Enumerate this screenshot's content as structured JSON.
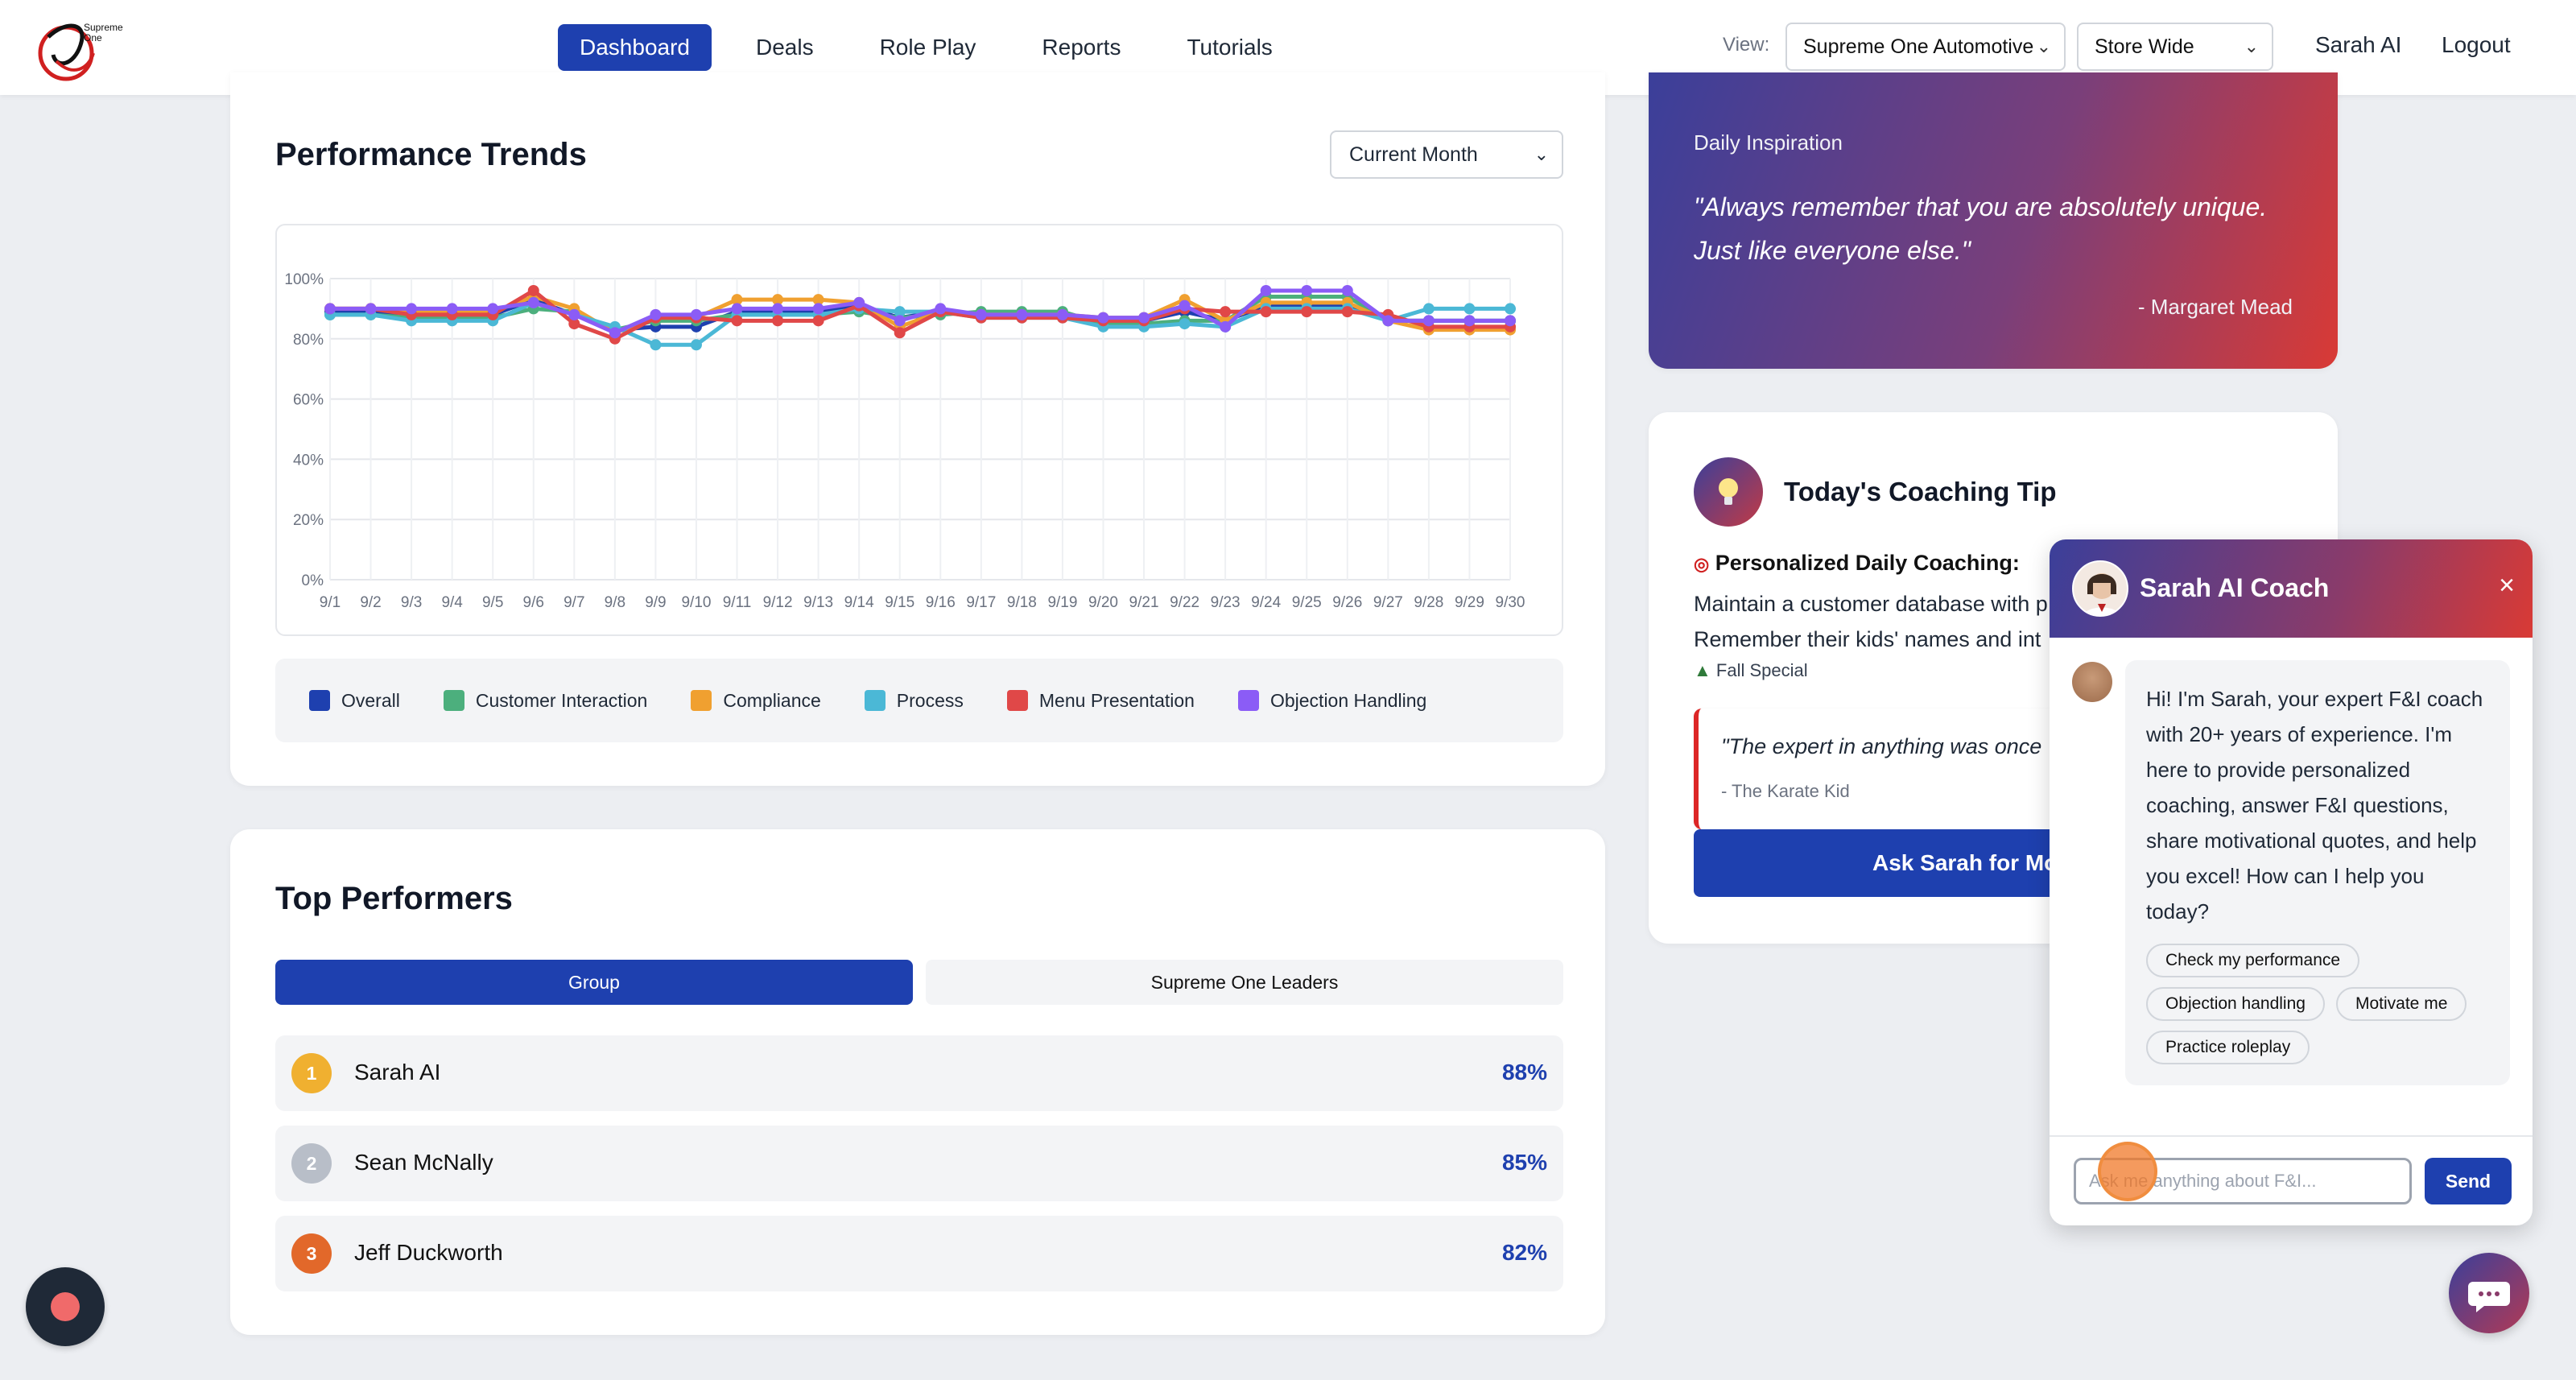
{
  "nav": {
    "logo_text": "Supreme One",
    "links": [
      "Dashboard",
      "Deals",
      "Role Play",
      "Reports",
      "Tutorials"
    ],
    "active": "Dashboard",
    "view_label": "View:",
    "dealer_select": "Supreme One Automotive",
    "scope_select": "Store Wide",
    "user": "Sarah AI",
    "logout": "Logout"
  },
  "performance": {
    "title": "Performance Trends",
    "period_select": "Current Month",
    "legend": [
      "Overall",
      "Customer Interaction",
      "Compliance",
      "Process",
      "Menu Presentation",
      "Objection Handling"
    ]
  },
  "chart_data": {
    "type": "line",
    "x": [
      "9/1",
      "9/2",
      "9/3",
      "9/4",
      "9/5",
      "9/6",
      "9/7",
      "9/8",
      "9/9",
      "9/10",
      "9/11",
      "9/12",
      "9/13",
      "9/14",
      "9/15",
      "9/16",
      "9/17",
      "9/18",
      "9/19",
      "9/20",
      "9/21",
      "9/22",
      "9/23",
      "9/24",
      "9/25",
      "9/26",
      "9/27",
      "9/28",
      "9/29",
      "9/30"
    ],
    "yticks": [
      "0%",
      "20%",
      "40%",
      "60%",
      "80%",
      "100%"
    ],
    "ylim": [
      0,
      100
    ],
    "grid": true,
    "series": [
      {
        "name": "Overall",
        "color": "#1e40af",
        "values": [
          89,
          89,
          88,
          88,
          88,
          93,
          88,
          83,
          84,
          84,
          89,
          89,
          89,
          91,
          87,
          89,
          88,
          88,
          88,
          86,
          86,
          89,
          86,
          91,
          91,
          91,
          86,
          86,
          86,
          86
        ]
      },
      {
        "name": "Customer Interaction",
        "color": "#4caf7d",
        "values": [
          88,
          88,
          87,
          87,
          87,
          90,
          89,
          83,
          86,
          86,
          88,
          88,
          88,
          89,
          87,
          88,
          89,
          89,
          89,
          85,
          85,
          86,
          86,
          94,
          94,
          94,
          86,
          86,
          86,
          86
        ]
      },
      {
        "name": "Compliance",
        "color": "#f0a030",
        "values": [
          90,
          90,
          89,
          89,
          89,
          94,
          90,
          82,
          87,
          87,
          93,
          93,
          93,
          92,
          84,
          89,
          88,
          88,
          88,
          87,
          87,
          93,
          86,
          92,
          92,
          92,
          86,
          83,
          83,
          83
        ]
      },
      {
        "name": "Process",
        "color": "#4bb8d6",
        "values": [
          88,
          88,
          86,
          86,
          86,
          92,
          88,
          84,
          78,
          78,
          88,
          88,
          88,
          90,
          89,
          89,
          87,
          87,
          87,
          84,
          84,
          85,
          84,
          90,
          90,
          90,
          86,
          90,
          90,
          90
        ]
      },
      {
        "name": "Menu Presentation",
        "color": "#e04848",
        "values": [
          90,
          90,
          88,
          88,
          88,
          96,
          85,
          80,
          87,
          87,
          86,
          86,
          86,
          91,
          82,
          89,
          87,
          87,
          87,
          86,
          86,
          90,
          89,
          89,
          89,
          89,
          88,
          84,
          84,
          84
        ]
      },
      {
        "name": "Objection Handling",
        "color": "#8b5cf6",
        "values": [
          90,
          90,
          90,
          90,
          90,
          92,
          88,
          82,
          88,
          88,
          90,
          90,
          90,
          92,
          86,
          90,
          88,
          88,
          88,
          87,
          87,
          91,
          84,
          96,
          96,
          96,
          86,
          86,
          86,
          86
        ]
      }
    ]
  },
  "top_performers": {
    "title": "Top Performers",
    "tabs": [
      "Group",
      "Supreme One Leaders"
    ],
    "list": [
      {
        "rank": "1",
        "name": "Sarah AI",
        "score": "88%",
        "color": "#f0b030"
      },
      {
        "rank": "2",
        "name": "Sean McNally",
        "score": "85%",
        "color": "#b8bec8"
      },
      {
        "rank": "3",
        "name": "Jeff Duckworth",
        "score": "82%",
        "color": "#e2682a"
      }
    ]
  },
  "inspiration": {
    "label": "Daily Inspiration",
    "quote": "\"Always remember that you are absolutely unique. Just like everyone else.\"",
    "author": "- Margaret Mead"
  },
  "coaching_tip": {
    "title": "Today's Coaching Tip",
    "subtitle": "Personalized Daily Coaching:",
    "line1": "Maintain a customer database with p",
    "line2": "Remember their kids' names and int",
    "tag": "Fall Special",
    "quote": "\"The expert in anything was once",
    "quote_author": "- The Karate Kid",
    "button": "Ask Sarah for Mor"
  },
  "chat": {
    "title": "Sarah AI Coach",
    "close": "×",
    "message": "Hi! I'm Sarah, your expert F&I coach with 20+ years of experience. I'm here to provide personalized coaching, answer F&I questions, share motivational quotes, and help you excel! How can I help you today?",
    "quick_replies": [
      "Check my performance",
      "Objection handling",
      "Motivate me",
      "Practice roleplay"
    ],
    "input_placeholder": "Ask me anything about F&I...",
    "send": "Send"
  }
}
